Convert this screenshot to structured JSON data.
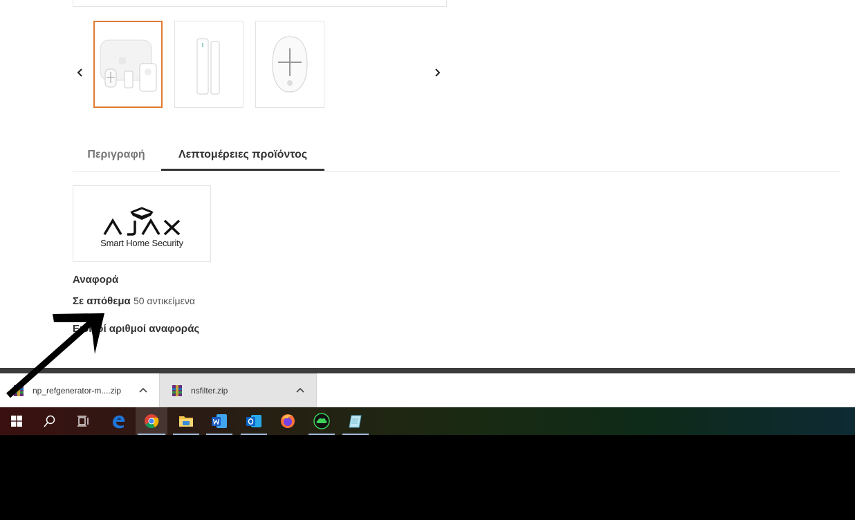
{
  "product": {
    "thumbnails": [
      {
        "name": "alarm-kit-thumbnail",
        "active": true
      },
      {
        "name": "door-sensor-thumbnail",
        "active": false
      },
      {
        "name": "key-fob-thumbnail",
        "active": false
      }
    ]
  },
  "tabs": [
    {
      "label": "Περιγραφή",
      "active": false
    },
    {
      "label": "Λεπτομέρειες προϊόντος",
      "active": true
    }
  ],
  "brand": {
    "logo_text": "AJAX",
    "tagline": "Smart Home Security"
  },
  "details": {
    "reference_label": "Αναφορά",
    "stock_label": "Σε απόθεμα",
    "stock_value": "50 αντικείμενα",
    "specific_refs_label": "Ειδικοί αριθμοί αναφοράς"
  },
  "downloads": [
    {
      "filename": "np_refgenerator-m....zip"
    },
    {
      "filename": "nsfilter.zip"
    }
  ],
  "taskbar": {
    "items": [
      "start-icon",
      "search-icon",
      "task-view-icon",
      "edge-icon",
      "chrome-icon",
      "file-explorer-icon",
      "word-icon",
      "outlook-icon",
      "firefox-icon",
      "cloud-app-icon",
      "notepad-icon"
    ]
  },
  "colors": {
    "accent_orange": "#e07a31",
    "tab_active": "#333333",
    "separator": "#3c3c3c",
    "taskbar_running": "#9fb9d6"
  }
}
